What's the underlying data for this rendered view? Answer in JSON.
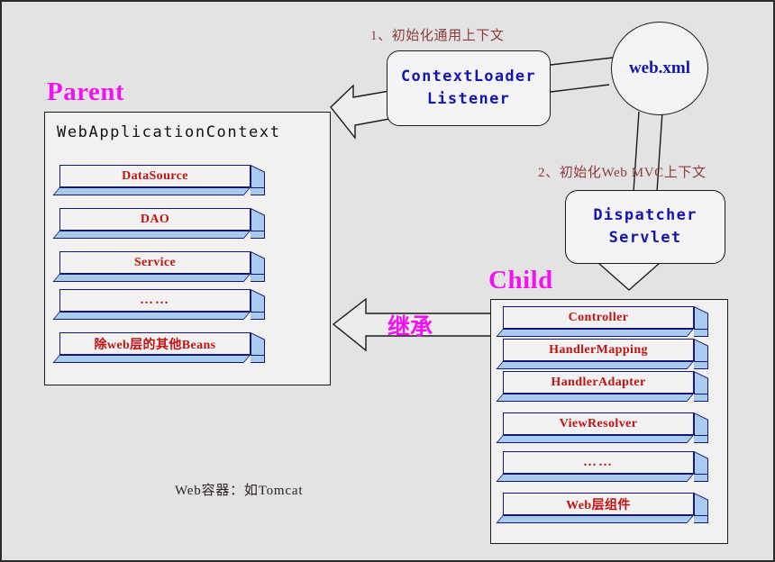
{
  "diagram": {
    "background_color": "#e3e3e3",
    "accent_magenta": "#f410f4",
    "accent_red": "#c41111",
    "accent_blue": "#1515b0",
    "bar_side_color": "#a8cbee",
    "note_color": "#8e3a3a"
  },
  "parent_section": {
    "title": "Parent",
    "panel_label": "WebApplicationContext",
    "beans": [
      {
        "label": "DataSource"
      },
      {
        "label": "DAO"
      },
      {
        "label": "Service"
      },
      {
        "label": "……"
      },
      {
        "label": "除web层的其他Beans"
      }
    ]
  },
  "child_section": {
    "title": "Child",
    "beans": [
      {
        "label": "Controller"
      },
      {
        "label": "HandlerMapping"
      },
      {
        "label": "HandlerAdapter"
      },
      {
        "label": "ViewResolver"
      },
      {
        "label": "……"
      },
      {
        "label": "Web层组件"
      }
    ]
  },
  "nodes": {
    "context_loader_listener": {
      "line1": "ContextLoader",
      "line2": "Listener"
    },
    "web_xml": {
      "label": "web.xml"
    },
    "dispatcher_servlet": {
      "line1": "Dispatcher",
      "line2": "Servlet"
    }
  },
  "annotations": {
    "step1": "1、初始化通用上下文",
    "step2": "2、初始化Web MVC上下文",
    "inheritance": "继承",
    "footer": "Web容器：如Tomcat"
  }
}
